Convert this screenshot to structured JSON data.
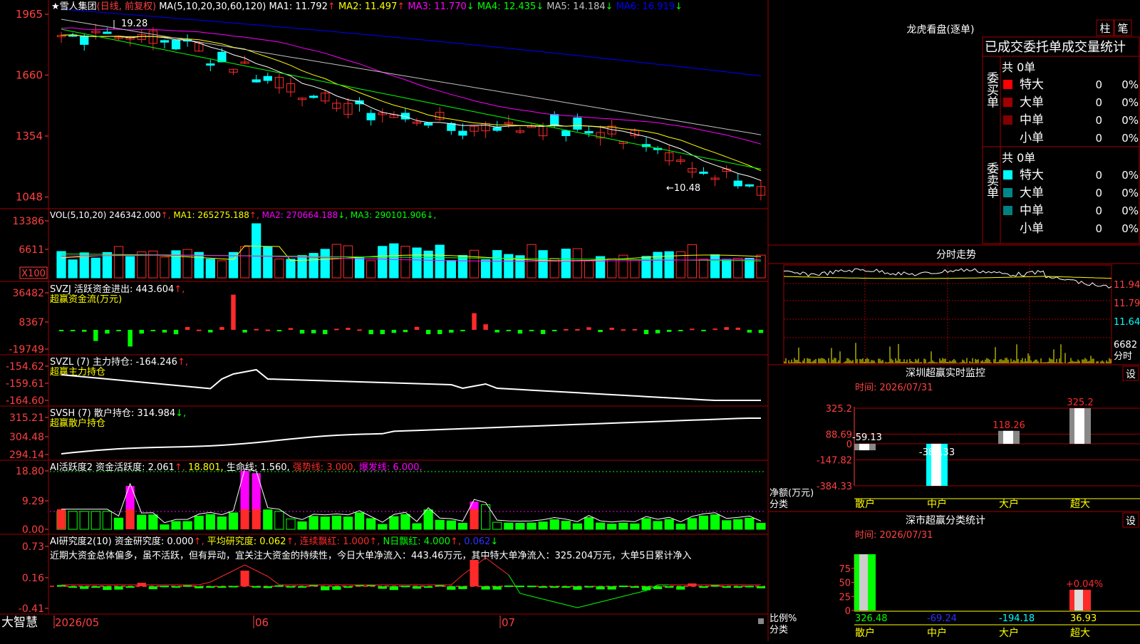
{
  "app": {
    "brand": "大智慧",
    "stock_name": "★雪人集团",
    "period": "(日线, 前复权)"
  },
  "colors": {
    "up": "#ff2a2a",
    "down": "#00ffff",
    "grid": "#a00000",
    "axis_text": "#ff4040",
    "ma1": "#ffffff",
    "ma2": "#ffff00",
    "ma3": "#ff00ff",
    "ma4": "#00ff00",
    "ma5": "#c0c0c0",
    "ma6": "#0000ff",
    "white": "#ffffff",
    "yellow": "#ffff00",
    "green": "#00ff00",
    "magenta": "#ff00ff"
  },
  "main": {
    "indicator": "MA(5,10,20,30,60,120)",
    "ma": [
      {
        "label": "MA1:",
        "value": "11.792",
        "arrow": "↑"
      },
      {
        "label": "MA2:",
        "value": "11.497",
        "arrow": "↑"
      },
      {
        "label": "MA3:",
        "value": "11.770",
        "arrow": "↓"
      },
      {
        "label": "MA4:",
        "value": "12.435",
        "arrow": "↓"
      },
      {
        "label": "MA5:",
        "value": "14.184",
        "arrow": "↓"
      },
      {
        "label": "MA6:",
        "value": "16.919",
        "arrow": "↓"
      }
    ],
    "axis": [
      "1965",
      "1660",
      "1354",
      "1048"
    ],
    "high_marker": "19.28",
    "low_marker": "←10.48"
  },
  "vol": {
    "label": "VOL(5,10,20)",
    "value": "246342.000",
    "arrow1": "↑",
    "ma": [
      {
        "label": "MA1:",
        "value": "265275.188",
        "arrow": "↑"
      },
      {
        "label": "MA2:",
        "value": "270664.188",
        "arrow": "↓"
      },
      {
        "label": "MA3:",
        "value": "290101.906",
        "arrow": "↓"
      }
    ],
    "axis": [
      "13386",
      "6611"
    ],
    "unit": "X100"
  },
  "svzj": {
    "label": "SVZJ  活跃资金进出:",
    "value": "443.604",
    "arrow": "↑,",
    "sub": "超赢资金流(万元)",
    "axis": [
      "36482",
      "8367",
      "-19749"
    ]
  },
  "svzl": {
    "label": "SVZL (7) 主力持仓:",
    "value": "-164.246",
    "arrow": "↑,",
    "sub": "超赢主力持仓",
    "axis": [
      "-154.62",
      "-159.61",
      "-164.60"
    ]
  },
  "svsh": {
    "label": "SVSH (7) 散户持仓:",
    "value": "314.984",
    "arrow": "↓,",
    "sub": "超赢散户持仓",
    "axis": [
      "315.21",
      "304.48",
      "294.14"
    ]
  },
  "ai1": {
    "label": "AI活跃度2 资金活跃度:",
    "value": "2.061",
    "arrow": "↑,",
    "v2": "18.801,",
    "life": "生命线: 1.560,",
    "strong": "强势线: 3.000,",
    "burst": "爆发线: 6.000,",
    "axis": [
      "18.80",
      "9.29",
      "0.00"
    ]
  },
  "ai2": {
    "label": "AI研究度2(10) 资金研究度:",
    "v1": "0.000",
    "a1": "↑,",
    "avg": "平均研究度: 0.062",
    "a2": "↑,",
    "lian": "连续飘红: 1.000",
    "a3": "↑,",
    "nri": "N日飘红: 4.000",
    "a4": "↑,",
    "v5": "0.062",
    "a5": "↓",
    "comment": "近期大资金总体偏多，虽不活跃，但有异动，宜关注大资金的持续性，今日大单净流入：443.46万元，其中特大单净流入：325.204万元，大单5日累计净入",
    "axis": [
      "0.73",
      "0.16",
      "-0.41"
    ]
  },
  "dates": [
    "2026/05",
    "06",
    "07"
  ],
  "right": {
    "lhb_title": "龙虎看盘(逐单)",
    "btn_zhu": "柱",
    "btn_bi": "笔",
    "tabs_title": "已成交委托单成交量统计",
    "buy": {
      "side_label": "委买单",
      "count": "共 0单",
      "rows": [
        {
          "name": "特大",
          "qty": "0",
          "pct": "0%",
          "color": "#ff0000"
        },
        {
          "name": "大单",
          "qty": "0",
          "pct": "0%",
          "color": "#a00000"
        },
        {
          "name": "中单",
          "qty": "0",
          "pct": "0%",
          "color": "#800000"
        },
        {
          "name": "小单",
          "qty": "0",
          "pct": "0%",
          "color": "#000000"
        }
      ]
    },
    "sell": {
      "side_label": "委卖单",
      "count": "共 0单",
      "rows": [
        {
          "name": "特大",
          "qty": "0",
          "pct": "0%",
          "color": "#00ffff"
        },
        {
          "name": "大单",
          "qty": "0",
          "pct": "0%",
          "color": "#008888"
        },
        {
          "name": "中单",
          "qty": "0",
          "pct": "0%",
          "color": "#008080"
        },
        {
          "name": "小单",
          "qty": "0",
          "pct": "0%",
          "color": "#000000"
        }
      ]
    },
    "intraday": {
      "title": "分时走势",
      "axis": [
        "11.94",
        "11.79",
        "11.64"
      ],
      "vol": "6682",
      "vol_unit": "分时"
    },
    "monitor": {
      "title": "深圳超赢实时监控",
      "btn": "设",
      "time": "时间: 2026/07/31",
      "axis": [
        "325.2",
        "88.69",
        "0",
        "-147.82",
        "-384.33"
      ],
      "ylabel": "净额(万元)",
      "xlabel": "分类",
      "categories": [
        "散户",
        "中户",
        "大户",
        "超大"
      ],
      "values": [
        -59.13,
        -384.33,
        118.26,
        325.2
      ],
      "value_labels": [
        "-59.13",
        "-384.33",
        "118.26",
        "325.2"
      ]
    },
    "classify": {
      "title": "深市超赢分类统计",
      "btn": "设",
      "time": "时间: 2026/07/31",
      "axis": [
        "75",
        "50",
        "25",
        "0"
      ],
      "ylabel": "比例%",
      "xlabel": "分类",
      "categories": [
        "散户",
        "中户",
        "大户",
        "超大"
      ],
      "values": [
        "326.48",
        "-69.24",
        "-194.18",
        "36.93"
      ],
      "bar_pcts": [
        100,
        0,
        0,
        36.93
      ],
      "note": "+0.04%"
    }
  }
}
